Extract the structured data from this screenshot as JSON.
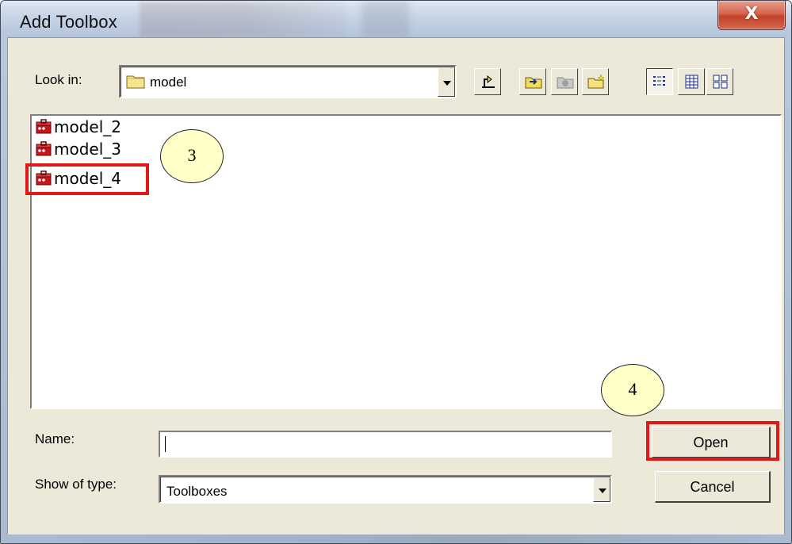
{
  "window": {
    "title": "Add Toolbox",
    "close_label": "X"
  },
  "look_in": {
    "label": "Look in:",
    "value": "model"
  },
  "toolbar": {
    "buttons": [
      {
        "name": "up-one-level",
        "icon": "folder-up-icon"
      },
      {
        "name": "connect-to-folder",
        "icon": "connect-folder-icon"
      },
      {
        "name": "disconnect-from-folder",
        "icon": "disconnect-folder-icon"
      },
      {
        "name": "new-folder",
        "icon": "new-folder-icon"
      },
      {
        "name": "details-view",
        "icon": "details-view-icon"
      },
      {
        "name": "list-view",
        "icon": "list-view-icon"
      },
      {
        "name": "thumbnails-view",
        "icon": "thumbnails-view-icon"
      }
    ]
  },
  "files": [
    {
      "name": "model_2",
      "icon": "toolbox-icon"
    },
    {
      "name": "model_3",
      "icon": "toolbox-icon"
    },
    {
      "name": "model_4",
      "icon": "toolbox-icon"
    }
  ],
  "callouts": {
    "step3": "3",
    "step4": "4"
  },
  "name_field": {
    "label": "Name:",
    "value": ""
  },
  "type_field": {
    "label": "Show of type:",
    "value": "Toolboxes"
  },
  "buttons": {
    "open": "Open",
    "cancel": "Cancel"
  },
  "colors": {
    "highlight": "#e01818",
    "callout_fill": "#ffffc8",
    "dialog_face": "#ece9d8"
  }
}
